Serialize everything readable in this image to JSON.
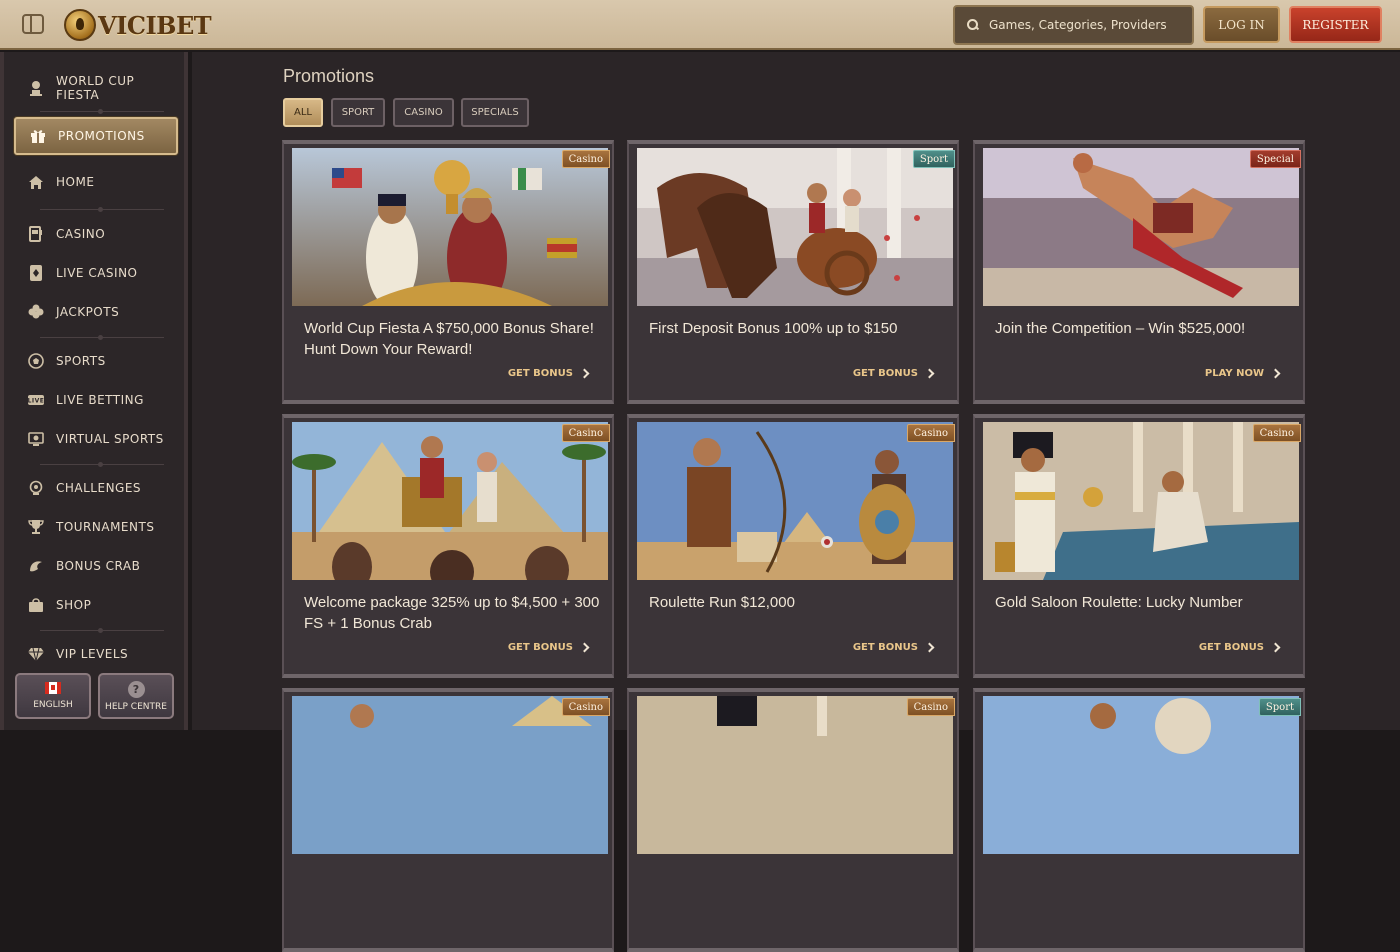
{
  "header": {
    "brand": "VICIBET",
    "search_placeholder": "Games, Categories, Providers",
    "login_label": "LOG IN",
    "register_label": "REGISTER"
  },
  "sidebar": {
    "items": [
      {
        "label": "WORLD CUP FIESTA",
        "icon": "trophy-bust-icon"
      },
      {
        "label": "PROMOTIONS",
        "icon": "gift-icon",
        "active": true
      },
      {
        "label": "HOME",
        "icon": "home-icon"
      },
      {
        "label": "CASINO",
        "icon": "slot-machine-icon"
      },
      {
        "label": "LIVE CASINO",
        "icon": "playing-card-icon"
      },
      {
        "label": "JACKPOTS",
        "icon": "clover-icon"
      },
      {
        "label": "SPORTS",
        "icon": "soccer-ball-icon"
      },
      {
        "label": "LIVE BETTING",
        "icon": "live-icon"
      },
      {
        "label": "VIRTUAL SPORTS",
        "icon": "virtual-screen-icon"
      },
      {
        "label": "CHALLENGES",
        "icon": "challenge-icon"
      },
      {
        "label": "TOURNAMENTS",
        "icon": "trophy-icon"
      },
      {
        "label": "BONUS CRAB",
        "icon": "crab-icon"
      },
      {
        "label": "SHOP",
        "icon": "shopping-bag-icon"
      },
      {
        "label": "VIP LEVELS",
        "icon": "diamond-icon"
      }
    ],
    "language_label": "ENGLISH",
    "help_label": "HELP CENTRE"
  },
  "main": {
    "title": "Promotions",
    "filters": [
      {
        "label": "ALL",
        "active": true
      },
      {
        "label": "SPORT"
      },
      {
        "label": "CASINO"
      },
      {
        "label": "SPECIALS"
      }
    ],
    "cards": [
      {
        "badge": "Casino",
        "title": "World Cup Fiesta A $750,000 Bonus Share! Hunt Down Your Reward!",
        "cta": "GET BONUS"
      },
      {
        "badge": "Sport",
        "title": "First Deposit Bonus 100% up to $150",
        "cta": "GET BONUS"
      },
      {
        "badge": "Special",
        "title": "Join the Competition – Win $525,000!",
        "cta": "PLAY NOW"
      },
      {
        "badge": "Casino",
        "title": "Welcome package 325% up to $4,500 + 300 FS + 1 Bonus Crab",
        "cta": "GET BONUS"
      },
      {
        "badge": "Casino",
        "title": "Roulette Run $12,000",
        "cta": "GET BONUS"
      },
      {
        "badge": "Casino",
        "title": "Gold Saloon Roulette: Lucky Number",
        "cta": "GET BONUS"
      },
      {
        "badge": "Casino",
        "title": "",
        "cta": ""
      },
      {
        "badge": "Casino",
        "title": "",
        "cta": ""
      },
      {
        "badge": "Sport",
        "title": "",
        "cta": ""
      }
    ]
  },
  "colors": {
    "accent_gold": "#e9c68a",
    "register_red": "#c9422c",
    "sidebar_bg": "#2c2628",
    "main_bg": "#2b2527"
  }
}
